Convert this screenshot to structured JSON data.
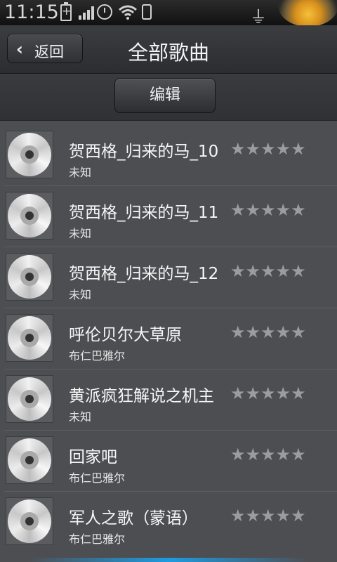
{
  "status_bar": {
    "time": "11:15",
    "icons": [
      "battery-charging-icon",
      "signal-icon",
      "alarm-icon",
      "wifi-icon",
      "phone-battery-icon",
      "usb-icon"
    ]
  },
  "header": {
    "back_label": "返回",
    "title": "全部歌曲"
  },
  "toolbar": {
    "edit_label": "编辑"
  },
  "songs": [
    {
      "title": "贺西格_归来的马_10",
      "artist": "未知",
      "rating": 0
    },
    {
      "title": "贺西格_归来的马_11",
      "artist": "未知",
      "rating": 0
    },
    {
      "title": "贺西格_归来的马_12",
      "artist": "未知",
      "rating": 0
    },
    {
      "title": "呼伦贝尔大草原",
      "artist": "布仁巴雅尔",
      "rating": 0
    },
    {
      "title": "黄派疯狂解说之机主",
      "artist": "未知",
      "rating": 0
    },
    {
      "title": "回家吧",
      "artist": "布仁巴雅尔",
      "rating": 0
    },
    {
      "title": "军人之歌（蒙语）",
      "artist": "布仁巴雅尔",
      "rating": 0
    }
  ],
  "colors": {
    "accent_glow": "#1e9be0",
    "background": "#4d4e52",
    "star": "#9c9c9e"
  }
}
